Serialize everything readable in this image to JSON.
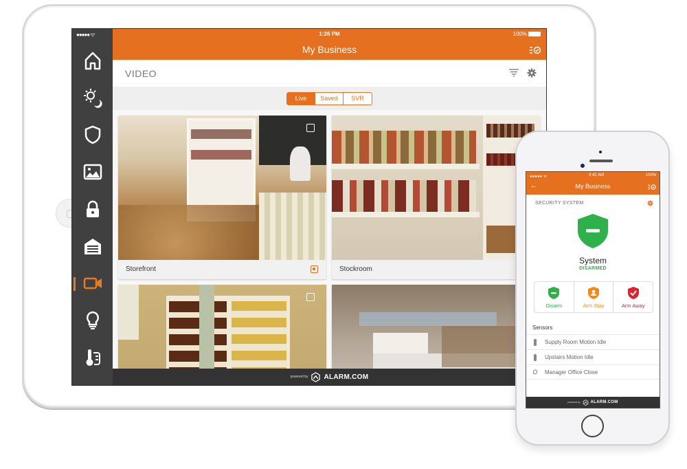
{
  "tablet": {
    "status": {
      "signal": "●●●●● ᯤ",
      "time": "1:26 PM",
      "battery": "100%"
    },
    "header": {
      "title": "My Business",
      "icon": "list-check-icon"
    },
    "sidebar": {
      "items": [
        {
          "name": "home",
          "icon": "home-icon",
          "active": false
        },
        {
          "name": "scenes",
          "icon": "sun-moon-icon",
          "active": false
        },
        {
          "name": "security",
          "icon": "shield-icon",
          "active": false
        },
        {
          "name": "images",
          "icon": "image-icon",
          "active": false
        },
        {
          "name": "locks",
          "icon": "lock-icon",
          "active": false
        },
        {
          "name": "garage",
          "icon": "garage-icon",
          "active": false
        },
        {
          "name": "video",
          "icon": "video-camera-icon",
          "active": true
        },
        {
          "name": "lights",
          "icon": "lightbulb-icon",
          "active": false
        },
        {
          "name": "thermostat",
          "icon": "thermostat-icon",
          "active": false
        }
      ]
    },
    "page": {
      "title": "VIDEO",
      "filter_icon": "filter-icon",
      "settings_icon": "gear-icon"
    },
    "tabs": [
      {
        "label": "Live",
        "active": true
      },
      {
        "label": "Saved",
        "active": false
      },
      {
        "label": "SVR",
        "active": false
      }
    ],
    "cameras": [
      {
        "label": "Storefront",
        "recording": true
      },
      {
        "label": "Stockroom",
        "recording": false
      },
      {
        "label": "",
        "recording": false
      },
      {
        "label": "",
        "recording": false
      }
    ],
    "footer": {
      "powered_by": "powered by",
      "brand": "ALARM.COM"
    }
  },
  "phone": {
    "status": {
      "signal": "●●●●● ᯤ",
      "time": "9:41 AM",
      "battery": "100%"
    },
    "header": {
      "title": "My Business",
      "back": "←"
    },
    "section_title": "SECURITY SYSTEM",
    "system": {
      "name": "System",
      "state": "DISARMED"
    },
    "colors": {
      "disarm": "#2eb04a",
      "stay": "#f28a1e",
      "away": "#d9232e",
      "accent": "#e5701f"
    },
    "actions": [
      {
        "label": "Disarm",
        "color": "#2eb04a"
      },
      {
        "label": "Arm Stay",
        "color": "#f28a1e"
      },
      {
        "label": "Arm Away",
        "color": "#d9232e"
      }
    ],
    "sensors_title": "Sensors",
    "sensors": [
      {
        "label": "Supply Room Motion Idle",
        "icon": "motion-sensor-icon"
      },
      {
        "label": "Upstairs Motion Idle",
        "icon": "motion-sensor-icon"
      },
      {
        "label": "Manager Office Close",
        "icon": "contact-sensor-icon"
      }
    ],
    "footer": {
      "powered_by": "powered by",
      "brand": "ALARM.COM"
    }
  }
}
